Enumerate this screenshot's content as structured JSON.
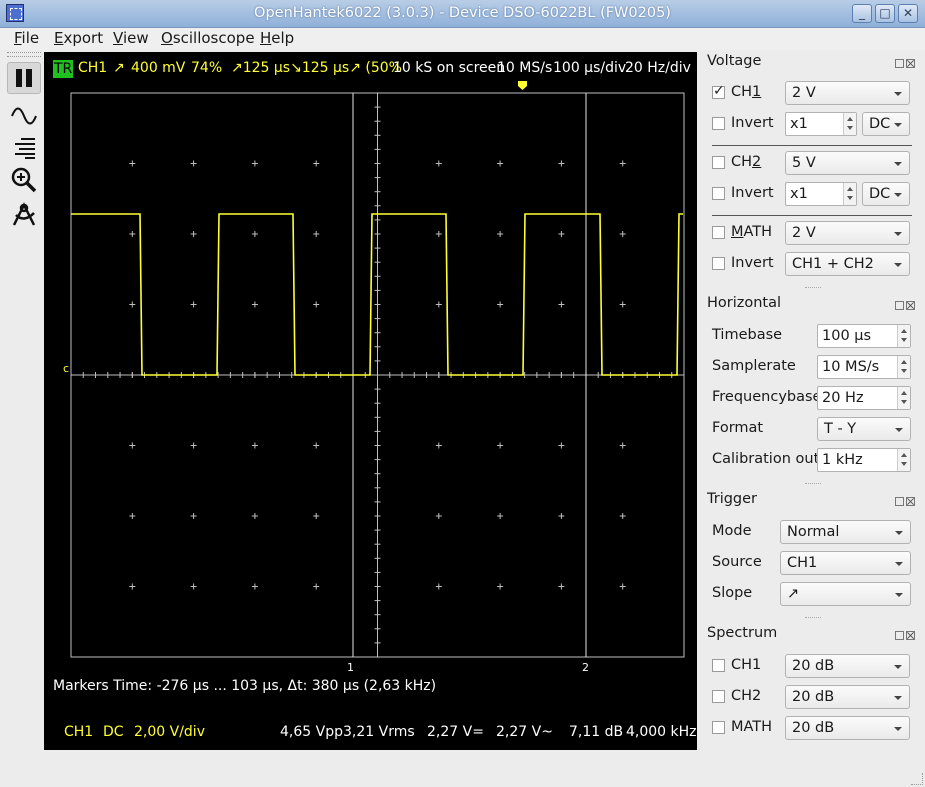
{
  "window": {
    "title": "OpenHantek6022 (3.0.3) - Device DSO-6022BL (FW0205)"
  },
  "menu": [
    "File",
    "Export",
    "View",
    "Oscilloscope",
    "Help"
  ],
  "menu_accel": [
    "F",
    "E",
    "V",
    "O",
    "H"
  ],
  "scope": {
    "trigger_badge": "TR",
    "top_channel": "CH1",
    "top_slope": "↗",
    "top_level": "400 mV",
    "top_pretrigger": "74%",
    "top_pulse": "↗125 µs↘125 µs↗ (50%",
    "top_samples": "10 kS on screen",
    "top_samplerate": "10 MS/s",
    "top_timebase": "100 µs/div",
    "top_freqbase": "20 Hz/div",
    "marker1": "1",
    "marker2": "2",
    "ground_marker": "c",
    "markers_line": "Markers  Time: -276 µs ... 103 µs,  Δt: 380 µs (2,63 kHz)",
    "bottom_channel": "CH1",
    "bottom_coupling": "DC",
    "bottom_vdiv": "2,00 V/div",
    "bottom_vpp": "4,65 Vpp",
    "bottom_vrms": "3,21 Vrms",
    "bottom_vdc": "2,27 V=",
    "bottom_vac": "2,27 V~",
    "bottom_db": "7,11 dB",
    "bottom_freq": "4,000 kHz",
    "colors": {
      "trace": "#ffff32",
      "grid": "#bfbfbf",
      "background": "#000000",
      "trigger_badge": "#1ec11e"
    }
  },
  "voltage": {
    "title": "Voltage",
    "ch1": {
      "label": "CH1",
      "accel": "1",
      "checked": true,
      "gain": "2 V",
      "invert": "Invert",
      "probe": "x1",
      "coupling": "DC"
    },
    "ch2": {
      "label": "CH2",
      "accel": "2",
      "checked": false,
      "gain": "5 V",
      "invert": "Invert",
      "probe": "x1",
      "coupling": "DC"
    },
    "math": {
      "label": "MATH",
      "accel": "M",
      "checked": false,
      "gain": "2 V",
      "invert": "Invert",
      "mode": "CH1 + CH2"
    }
  },
  "horizontal": {
    "title": "Horizontal",
    "timebase_label": "Timebase",
    "timebase": "100 µs",
    "samplerate_label": "Samplerate",
    "samplerate": "10 MS/s",
    "freqbase_label": "Frequencybase",
    "freqbase": "20 Hz",
    "format_label": "Format",
    "format": "T - Y",
    "calout_label": "Calibration out",
    "calout": "1 kHz"
  },
  "trigger": {
    "title": "Trigger",
    "mode_label": "Mode",
    "mode": "Normal",
    "source_label": "Source",
    "source": "CH1",
    "slope_label": "Slope",
    "slope": "↗"
  },
  "spectrum": {
    "title": "Spectrum",
    "ch1": {
      "label": "CH1",
      "value": "20 dB"
    },
    "ch2": {
      "label": "CH2",
      "value": "20 dB"
    },
    "math": {
      "label": "MATH",
      "value": "20 dB"
    }
  },
  "toolbar_icons": [
    "pause-icon",
    "waveform-icon",
    "measure-lines-icon",
    "zoom-icon",
    "cursor-tool-icon"
  ]
}
